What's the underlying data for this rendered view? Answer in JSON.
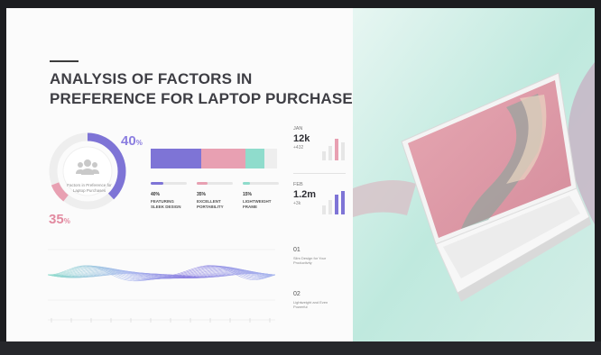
{
  "title": {
    "line1": "ANALYSIS OF FACTORS IN",
    "line2": "PREFERENCE FOR LAPTOP PURCHASES"
  },
  "donut": {
    "label": "Factors in Preference for Laptop Purchases",
    "top_value": "40",
    "top_unit": "%",
    "bottom_value": "35",
    "bottom_unit": "%"
  },
  "stacked_bar": {
    "segments": [
      {
        "value": 40,
        "color": "#7e74d6"
      },
      {
        "value": 35,
        "color": "#e8a0b2"
      },
      {
        "value": 15,
        "color": "#8fdccc"
      },
      {
        "value": 10,
        "color": "#eeeeee"
      }
    ]
  },
  "factors": [
    {
      "pct": "40%",
      "name_line1": "FEATURING",
      "name_line2": "SLEEK DESIGN",
      "fill": 0.35,
      "color": "#7e74d6"
    },
    {
      "pct": "35%",
      "name_line1": "EXCELLENT",
      "name_line2": "PORTABILITY",
      "fill": 0.3,
      "color": "#e8a0b2"
    },
    {
      "pct": "15%",
      "name_line1": "LIGHTWEIGHT",
      "name_line2": "FRAME",
      "fill": 0.2,
      "color": "#8fdccc"
    }
  ],
  "stats": [
    {
      "month": "JAN",
      "value": "12k",
      "delta": "+432"
    },
    {
      "month": "FEB",
      "value": "1.2m",
      "delta": "+3k"
    }
  ],
  "notes": [
    {
      "num": "01",
      "line1": "Slim Design for Your",
      "line2": "Productivity"
    },
    {
      "num": "02",
      "line1": "Lightweight and Even",
      "line2": "Powerful"
    }
  ],
  "colors": {
    "purple": "#7e74d6",
    "pink": "#e8a0b2",
    "mint": "#8fdccc",
    "text": "#3e3e44"
  },
  "icons": {
    "donut_center": "people-icon"
  }
}
